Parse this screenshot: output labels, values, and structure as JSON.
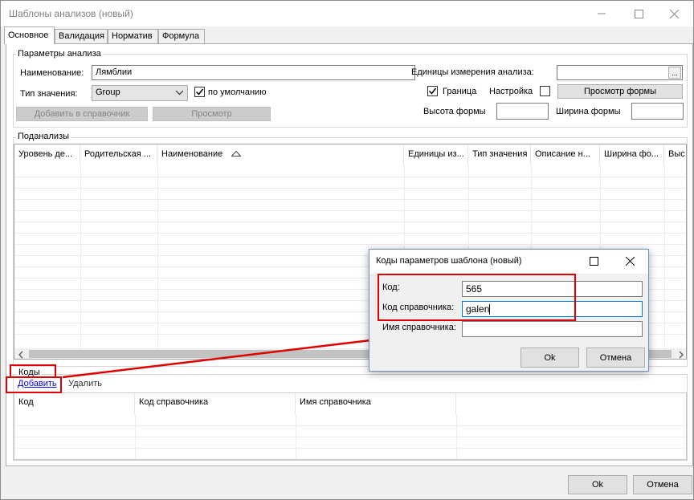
{
  "window": {
    "title": "Шаблоны анализов (новый)",
    "minimize_icon": "minimize-icon",
    "maximize_icon": "maximize-icon",
    "close_icon": "close-icon"
  },
  "tabs": [
    {
      "label": "Основное",
      "active": true
    },
    {
      "label": "Валидация",
      "active": false
    },
    {
      "label": "Норматив",
      "active": false
    },
    {
      "label": "Формула",
      "active": false
    }
  ],
  "analysis_params": {
    "legend": "Параметры анализа",
    "name_label": "Наименование:",
    "name_value": "Лямблии",
    "value_type_label": "Тип значения:",
    "value_type_selected": "Group",
    "default_label": "по умолчанию",
    "default_checked": true,
    "add_to_directory_button": "Добавить в справочник",
    "preview_button": "Просмотр",
    "units_label": "Единицы измерения анализа:",
    "units_value": "",
    "units_browse": "...",
    "border_label": "Граница",
    "border_checked": true,
    "setting_label": "Настройка",
    "setting_checked": false,
    "preview_form_button": "Просмотр формы",
    "form_height_label": "Высота формы",
    "form_height_value": "",
    "form_width_label": "Ширина формы",
    "form_width_value": ""
  },
  "subanalyses": {
    "legend": "Поданализы",
    "columns": [
      "Уровень де...",
      "Родительская ...",
      "Наименование",
      "Единицы из...",
      "Тип значения",
      "Описание н...",
      "Ширина фо...",
      "Выс"
    ],
    "sort_icon": "sort-ascending-icon",
    "scroll_left_icon": "chevron-left-icon",
    "scroll_right_icon": "chevron-right-icon"
  },
  "codes": {
    "legend": "Коды",
    "add_link": "Добавить",
    "delete_link": "Удалить",
    "columns": [
      "Код",
      "Код справочника",
      "Имя справочника"
    ]
  },
  "footer": {
    "ok_button": "Ok",
    "cancel_button": "Отмена"
  },
  "dialog": {
    "title": "Коды параметров шаблона (новый)",
    "code_label": "Код:",
    "code_value": "565",
    "dir_code_label": "Код справочника:",
    "dir_code_value": "galen",
    "dir_name_label": "Имя справочника:",
    "dir_name_value": "",
    "ok_button": "Ok",
    "cancel_button": "Отмена"
  },
  "annotation_color": "#e00000"
}
